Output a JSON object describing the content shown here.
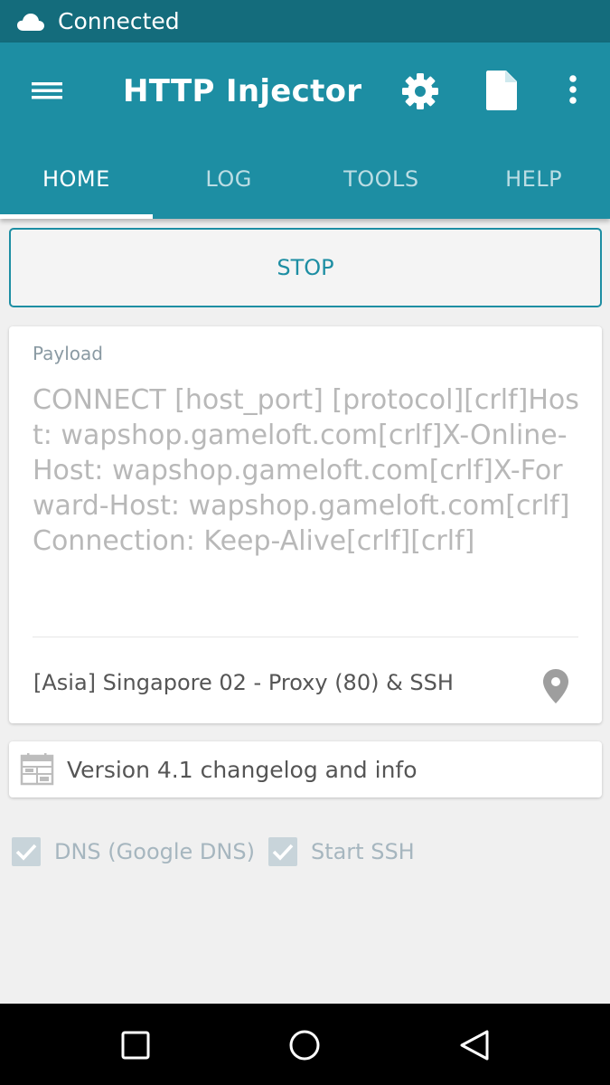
{
  "status_bar": {
    "icon": "cloud-icon",
    "text": "Connected"
  },
  "toolbar": {
    "title": "HTTP Injector",
    "icons": [
      "menu-icon",
      "gear-icon",
      "file-icon",
      "more-vert-icon"
    ]
  },
  "tabs": [
    {
      "label": "HOME",
      "active": true
    },
    {
      "label": "LOG",
      "active": false
    },
    {
      "label": "TOOLS",
      "active": false
    },
    {
      "label": "HELP",
      "active": false
    }
  ],
  "stop_button": {
    "label": "STOP"
  },
  "payload": {
    "label": "Payload",
    "value": "CONNECT [host_port] [protocol][crlf]Host: wapshop.gameloft.com[crlf]X-Online-Host: wapshop.gameloft.com[crlf]X-Forward-Host: wapshop.gameloft.com[crlf]Connection: Keep-Alive[crlf][crlf]",
    "server": "[Asia] Singapore 02 - Proxy (80) & SSH",
    "server_icon": "location-pin-icon"
  },
  "changelog": {
    "icon": "calendar-icon",
    "label": "Version 4.1 changelog and info"
  },
  "options": [
    {
      "label": "DNS (Google DNS)",
      "checked": true
    },
    {
      "label": "Start SSH",
      "checked": true
    }
  ],
  "nav_bar": {
    "icons": [
      "recent-apps-icon",
      "home-icon",
      "back-icon"
    ]
  },
  "colors": {
    "status_bar": "#146c7c",
    "primary": "#1d8ea3",
    "background": "#f0f0f0",
    "checkbox": "#c8d4da"
  }
}
